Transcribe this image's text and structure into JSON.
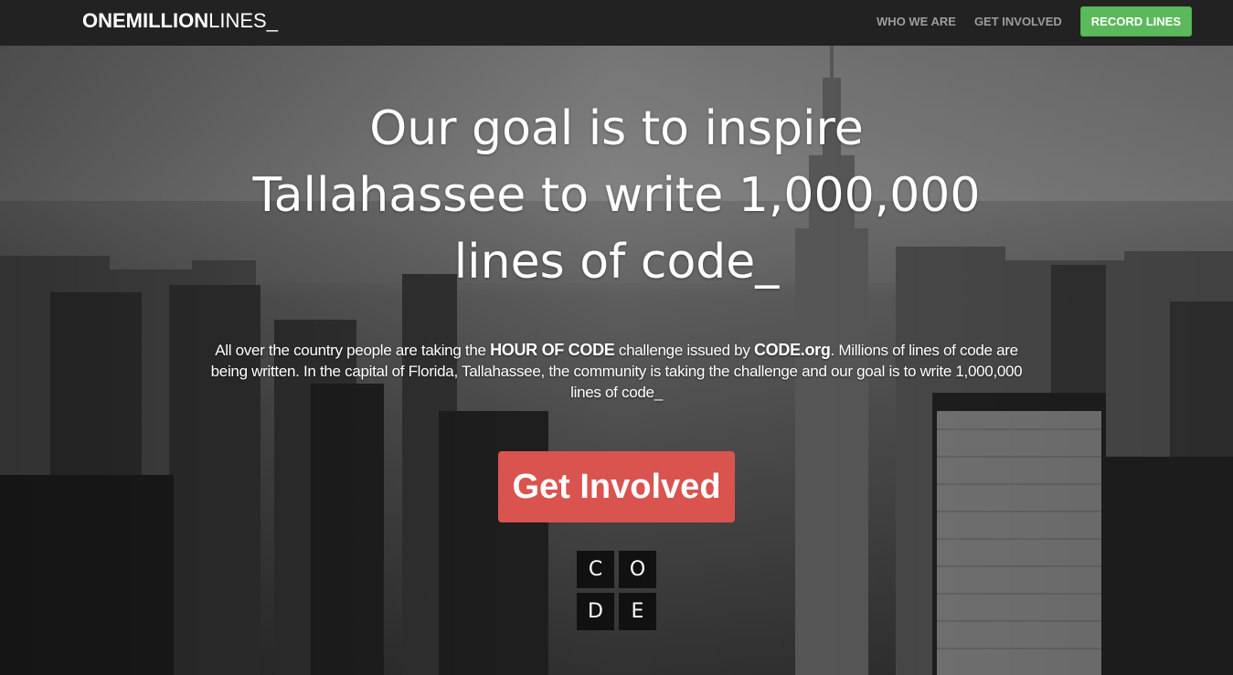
{
  "navbar": {
    "brand_bold": "ONEMILLION",
    "brand_light": "LINES_",
    "links": [
      "WHO WE ARE",
      "GET INVOLVED"
    ],
    "record_button": "RECORD LINES",
    "record_color": "#5cb85c",
    "background": "#222222"
  },
  "hero": {
    "headline_lines": [
      "Our goal is to inspire",
      "Tallahassee to write 1,000,000",
      "lines of code_"
    ],
    "lead": {
      "p1": "All over the country people are taking the ",
      "b1": "HOUR OF CODE",
      "p2": " challenge issued by ",
      "b2": "CODE.org",
      "p3": ". Millions of lines of code are being written. In the capital of Florida, Tallahassee, the community is taking the challenge and our goal is to write 1,000,000 lines of code_"
    },
    "cta_label": "Get Involved",
    "cta_color": "#d9534f",
    "code_logo_letters": [
      "C",
      "O",
      "D",
      "E"
    ],
    "background_description_icon": "city-skyline-image"
  }
}
